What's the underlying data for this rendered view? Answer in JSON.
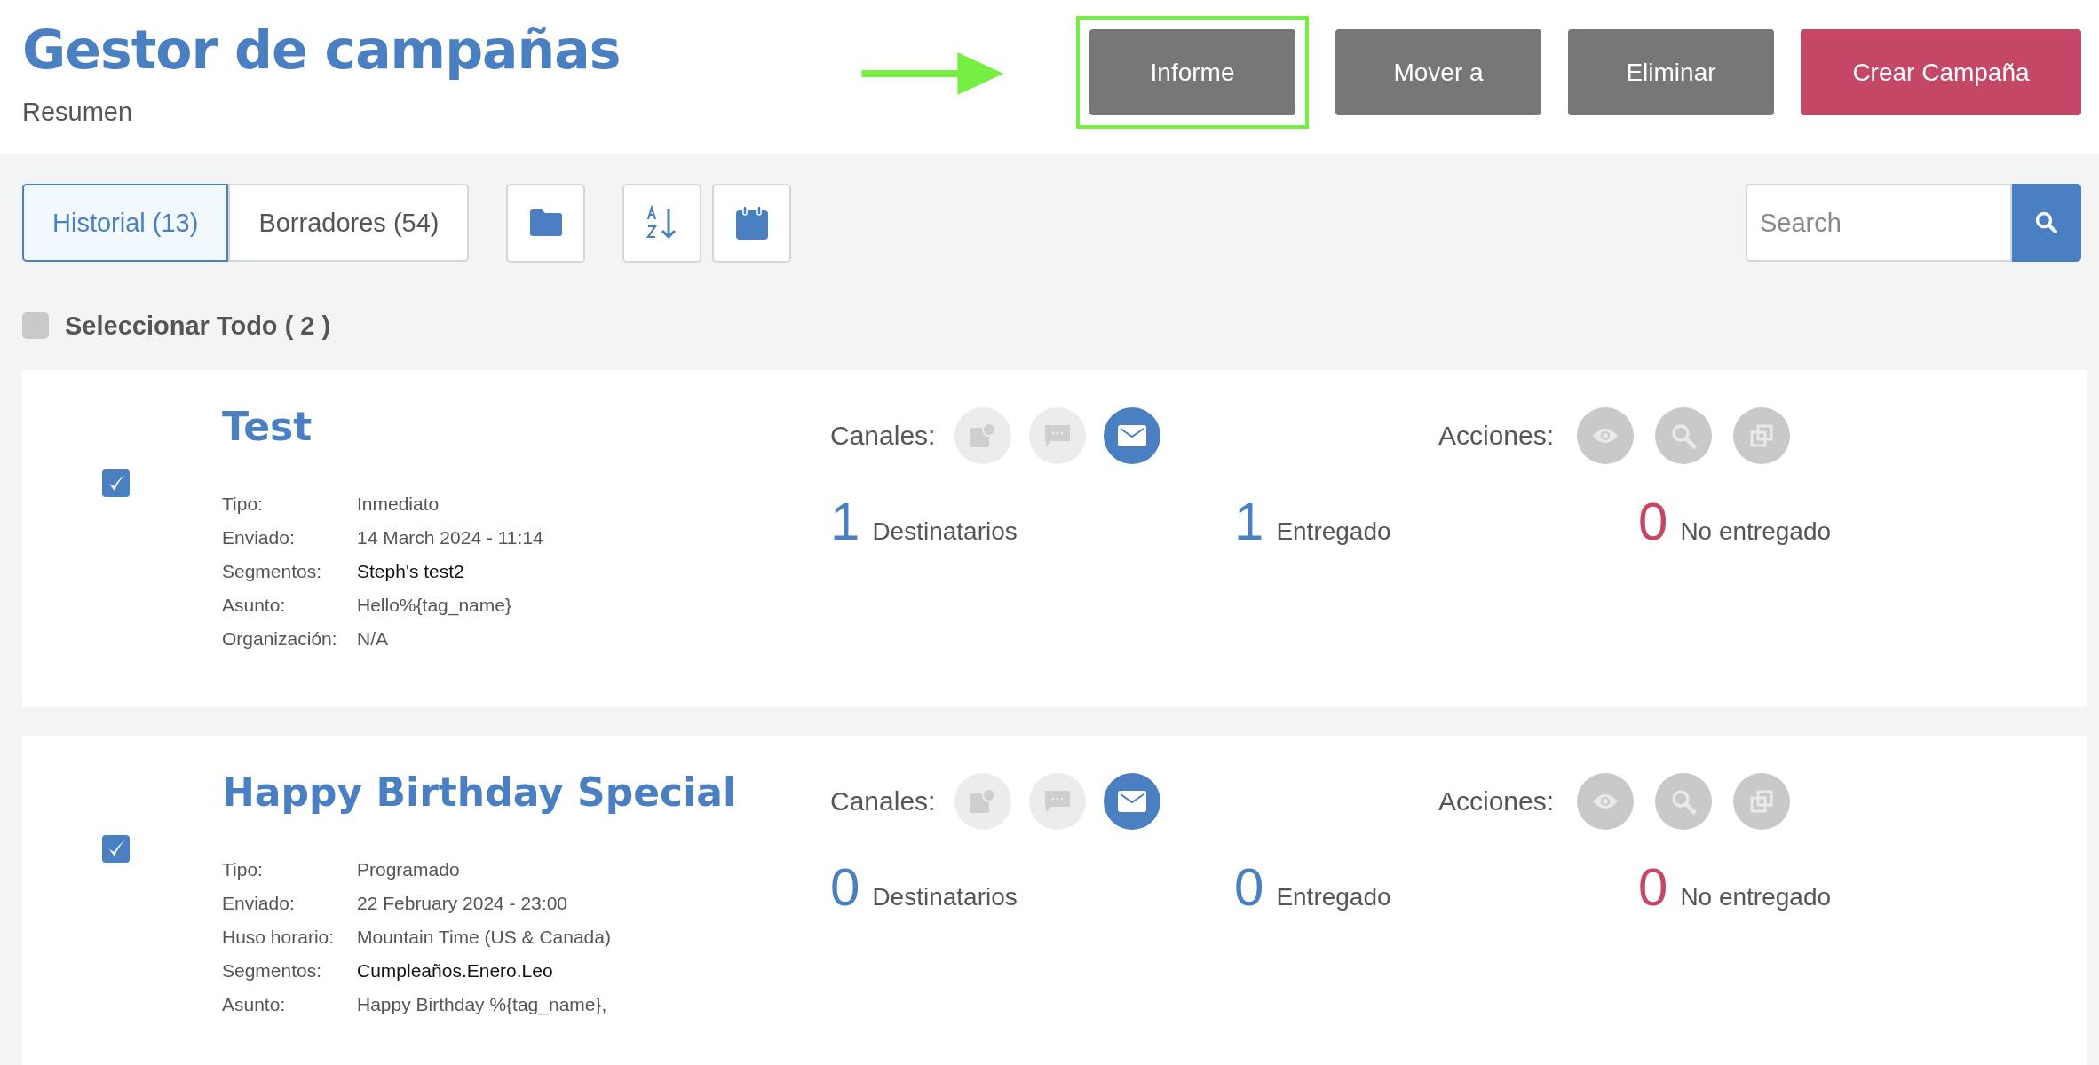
{
  "header": {
    "title": "Gestor de campañas",
    "subtitle": "Resumen",
    "buttons": [
      {
        "label": "Informe",
        "kind": "neutral",
        "highlighted": true
      },
      {
        "label": "Mover a",
        "kind": "neutral",
        "highlighted": false
      },
      {
        "label": "Eliminar",
        "kind": "neutral",
        "highlighted": false
      },
      {
        "label": "Crear Campaña",
        "kind": "primary",
        "highlighted": false
      }
    ]
  },
  "tabs": [
    {
      "label": "Historial (13)",
      "selected": true
    },
    {
      "label": "Borradores (54)",
      "selected": false
    }
  ],
  "search": {
    "placeholder": "Search"
  },
  "select_all": {
    "label": "Seleccionar Todo ( 2 )",
    "checked": false
  },
  "campaigns": [
    {
      "title": "Test",
      "checked": true,
      "details": [
        {
          "label": "Tipo:",
          "value": "Inmediato",
          "kind": "plain"
        },
        {
          "label": "Enviado:",
          "value": "14 March 2024 - 11:14",
          "kind": "plain"
        },
        {
          "label": "Segmentos:",
          "value": "Steph's test2",
          "kind": "segment"
        },
        {
          "label": "Asunto:",
          "value": "Hello%{tag_name}",
          "kind": "plain"
        },
        {
          "label": "Organización:",
          "value": "N/A",
          "kind": "plain"
        }
      ],
      "channels_label": "Canales:",
      "channels": [
        {
          "kind": "push",
          "active": false
        },
        {
          "kind": "sms",
          "active": false
        },
        {
          "kind": "email",
          "active": true
        }
      ],
      "actions_label": "Acciones:",
      "actions": [
        {
          "kind": "view"
        },
        {
          "kind": "search"
        },
        {
          "kind": "duplicate"
        }
      ],
      "stats": [
        {
          "value": "1",
          "label": "Destinatarios",
          "color": "#4a7fc1"
        },
        {
          "value": "1",
          "label": "Entregado",
          "color": "#4a7fc1"
        },
        {
          "value": "0",
          "label": "No entregado",
          "color": "#c44766"
        }
      ]
    },
    {
      "title": "Happy Birthday Special",
      "checked": true,
      "details": [
        {
          "label": "Tipo:",
          "value": "Programado",
          "kind": "plain"
        },
        {
          "label": "Enviado:",
          "value": "22 February 2024 - 23:00",
          "kind": "plain"
        },
        {
          "label": "Huso horario:",
          "value": "Mountain Time (US & Canada)",
          "kind": "plain"
        },
        {
          "label": "Segmentos:",
          "value": "Cumpleaños.Enero.Leo",
          "kind": "segment"
        },
        {
          "label": "Asunto:",
          "value": "Happy Birthday %{tag_name},",
          "kind": "plain"
        }
      ],
      "channels_label": "Canales:",
      "channels": [
        {
          "kind": "push",
          "active": false
        },
        {
          "kind": "sms",
          "active": false
        },
        {
          "kind": "email",
          "active": true
        }
      ],
      "actions_label": "Acciones:",
      "actions": [
        {
          "kind": "view"
        },
        {
          "kind": "search"
        },
        {
          "kind": "duplicate"
        }
      ],
      "stats": [
        {
          "value": "0",
          "label": "Destinatarios",
          "color": "#4a7fc1"
        },
        {
          "value": "0",
          "label": "Entregado",
          "color": "#4a7fc1"
        },
        {
          "value": "0",
          "label": "No entregado",
          "color": "#c44766"
        }
      ]
    }
  ]
}
